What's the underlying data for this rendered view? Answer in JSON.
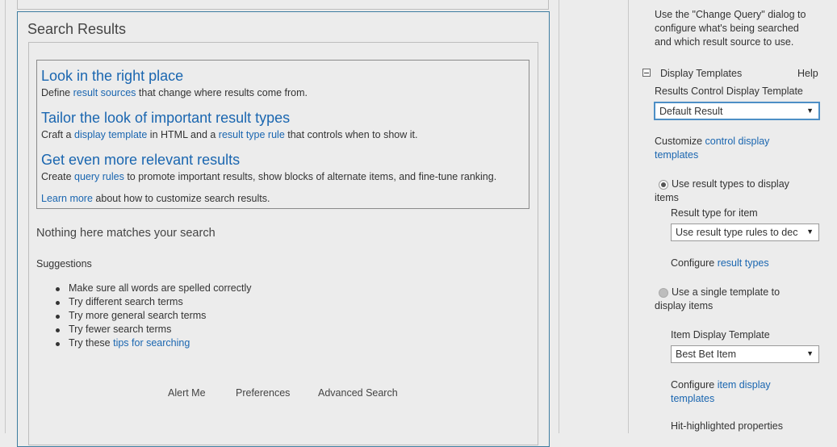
{
  "web_part": {
    "title": "Search Results",
    "promo": [
      {
        "heading": "Look in the right place",
        "text_before": "Define ",
        "link": "result sources",
        "text_after": " that change where results come from."
      },
      {
        "heading": "Tailor the look of important result types",
        "text_before": "Craft a ",
        "link": "display template",
        "text_mid": " in HTML and a ",
        "link2": "result type rule",
        "text_after": " that controls when to show it."
      },
      {
        "heading": "Get even more relevant results",
        "text_before": "Create ",
        "link": "query rules",
        "text_after": " to promote important results, show blocks of alternate items, and fine-tune ranking."
      }
    ],
    "learn_more_link": "Learn more",
    "learn_more_text": " about how to customize search results.",
    "no_match": "Nothing here matches your search",
    "suggestions_title": "Suggestions",
    "suggestions": [
      "Make sure all words are spelled correctly",
      "Try different search terms",
      "Try more general search terms",
      "Try fewer search terms"
    ],
    "tips_prefix": "Try these ",
    "tips_link": "tips for searching",
    "footer": [
      "Alert Me",
      "Preferences",
      "Advanced Search"
    ]
  },
  "tool_pane": {
    "intro": [
      "Use the \"Change Query\" dialog to",
      "configure what's being searched",
      "and which result source to use."
    ],
    "section_title": "Display Templates",
    "help": "Help",
    "results_control_label": "Results Control Display Template",
    "results_control_value": "Default Result",
    "customize_prefix": "Customize ",
    "customize_link_1": "control display",
    "customize_link_2": "templates",
    "radio1_line1": "Use result types to display",
    "radio1_line2": "items",
    "result_type_label": "Result type for item",
    "result_type_value": "Use result type rules to dec",
    "configure_prefix": "Configure ",
    "configure_link": "result types",
    "radio2_line1": "Use a single template to",
    "radio2_line2": "display items",
    "item_template_label": "Item Display Template",
    "item_template_value": "Best Bet Item",
    "configure_item_prefix": "Configure ",
    "configure_item_link_1": "item display",
    "configure_item_link_2": "templates",
    "hit_highlighted": "Hit-highlighted properties"
  }
}
